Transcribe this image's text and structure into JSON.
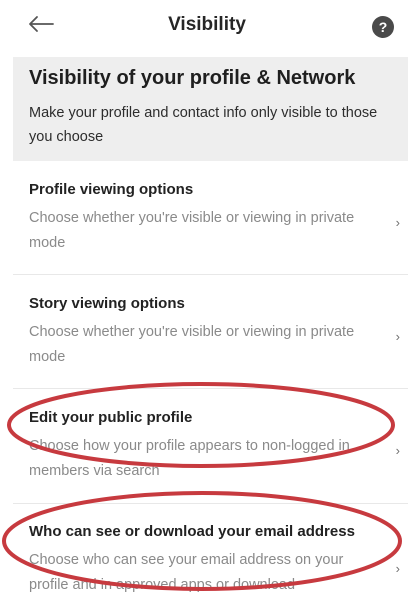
{
  "header": {
    "title": "Visibility",
    "back_icon": "arrow-left-icon",
    "help_icon": "help-icon",
    "help_glyph": "?"
  },
  "intro": {
    "title": "Visibility of your profile & Network",
    "description": "Make your profile and contact info only visible to those you choose"
  },
  "settings": [
    {
      "title": "Profile viewing options",
      "description": "Choose whether you're visible or viewing in private mode"
    },
    {
      "title": "Story viewing options",
      "description": "Choose whether you're visible or viewing in private mode"
    },
    {
      "title": "Edit your public profile",
      "description": "Choose how your profile appears to non-logged in members via search"
    },
    {
      "title": "Who can see or download your email address",
      "description": "Choose who can see your email address on your profile and in approved apps or download"
    }
  ],
  "chevron_glyph": "›",
  "annotation_color": "#c73a3f"
}
